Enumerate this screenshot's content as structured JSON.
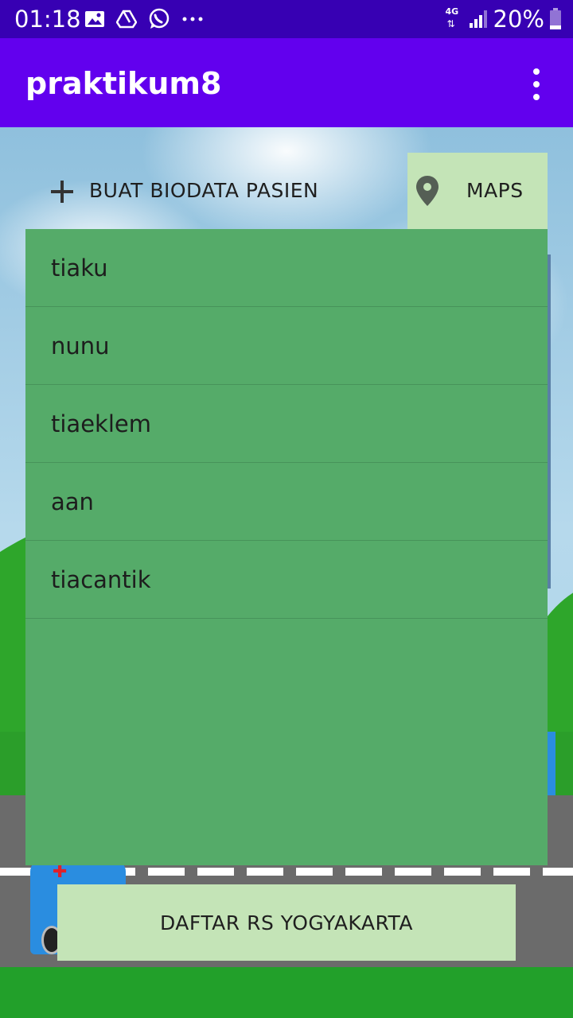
{
  "status_bar": {
    "time": "01:18",
    "network": "4G",
    "battery": "20%",
    "icons_left": [
      "image-icon",
      "drive-icon",
      "whatsapp-icon",
      "more-notifications-icon"
    ],
    "icons_right": [
      "network-4g-icon",
      "signal-icon",
      "battery-icon"
    ]
  },
  "app_bar": {
    "title": "praktikum8",
    "overflow_icon": "more-vert-icon"
  },
  "actions": {
    "add_label": "BUAT BIODATA PASIEN",
    "add_icon": "plus-icon",
    "maps_label": "MAPS",
    "maps_icon": "location-pin-icon"
  },
  "patients": [
    "tiaku",
    "nunu",
    "tiaeklem",
    "aan",
    "tiacantik"
  ],
  "bottom_button": "DAFTAR RS YOGYAKARTA",
  "colors": {
    "status_bar": "#3700b3",
    "app_bar": "#6200ee",
    "list_background": "#55ab69",
    "button_background": "#c4e4b7"
  }
}
